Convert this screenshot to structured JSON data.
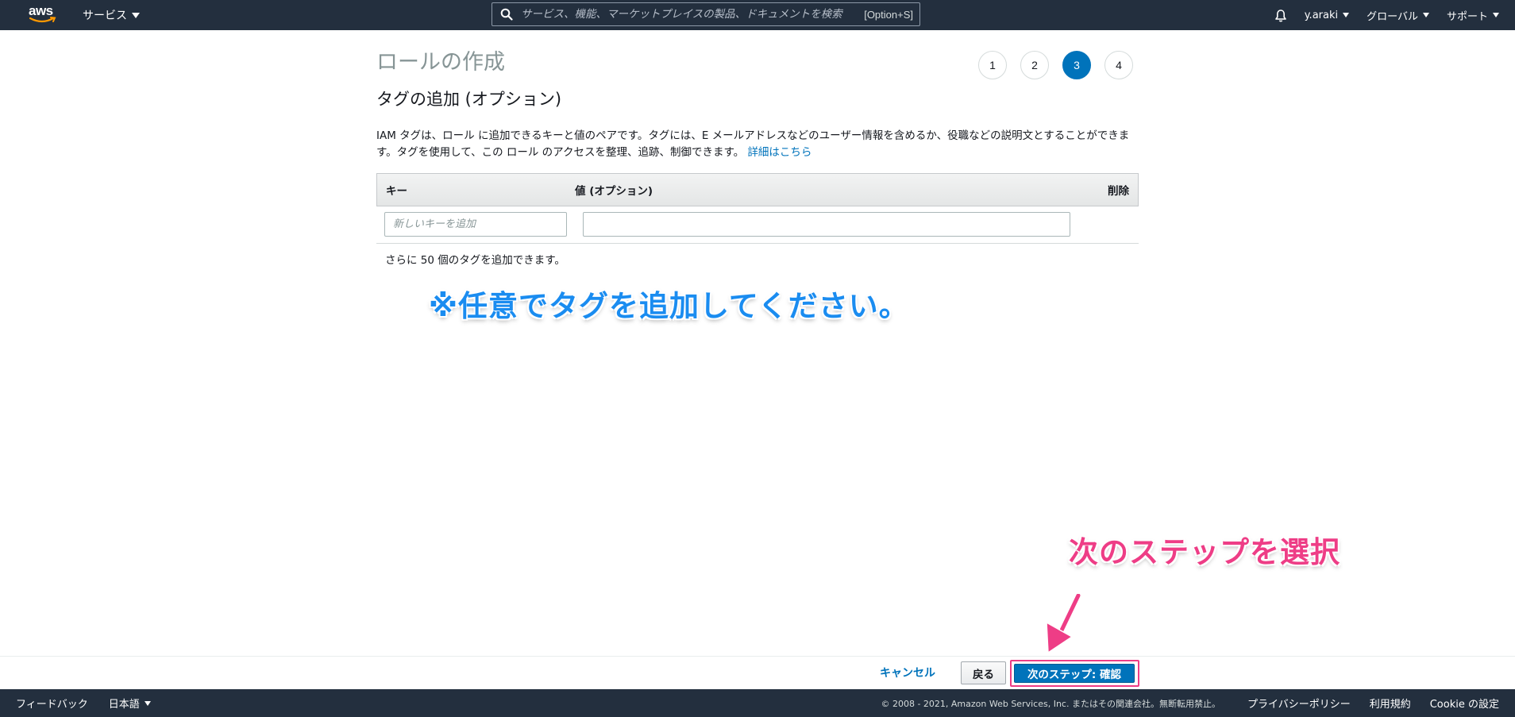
{
  "topnav": {
    "logo_text": "aws",
    "services_label": "サービス",
    "search_placeholder": "サービス、機能、マーケットプレイスの製品、ドキュメントを検索",
    "search_shortcut": "[Option+S]",
    "user_label": "y.araki",
    "region_label": "グローバル",
    "support_label": "サポート"
  },
  "page": {
    "title": "ロールの作成",
    "section_title": "タグの追加 (オプション)",
    "description": "IAM タグは、ロール に追加できるキーと値のペアです。タグには、E メールアドレスなどのユーザー情報を含めるか、役職などの説明文とすることができます。タグを使用して、この ロール のアクセスを整理、追跡、制御できます。",
    "learn_more_link": "詳細はこちら"
  },
  "stepper": {
    "steps": [
      "1",
      "2",
      "3",
      "4"
    ],
    "active_step": 3
  },
  "tags_table": {
    "headers": {
      "key": "キー",
      "value": "値 (オプション)",
      "delete": "削除"
    },
    "key_placeholder": "新しいキーを追加",
    "value_current": "",
    "remaining_text": "さらに 50 個のタグを追加できます。"
  },
  "annotations": {
    "note": "※任意でタグを追加してください。",
    "next_hint": "次のステップを選択",
    "note_color": "#1a8cf0",
    "hint_color": "#ee3d86"
  },
  "actions": {
    "cancel_label": "キャンセル",
    "back_label": "戻る",
    "next_label": "次のステップ: 確認"
  },
  "footer": {
    "feedback_label": "フィードバック",
    "language_label": "日本語",
    "copyright": "© 2008 - 2021, Amazon Web Services, Inc. またはその関連会社。無断転用禁止。",
    "privacy_label": "プライバシーポリシー",
    "terms_label": "利用規約",
    "cookie_label": "Cookie の設定"
  },
  "colors": {
    "nav_bg": "#232f3e",
    "primary": "#0073bb",
    "link": "#0073bb"
  }
}
